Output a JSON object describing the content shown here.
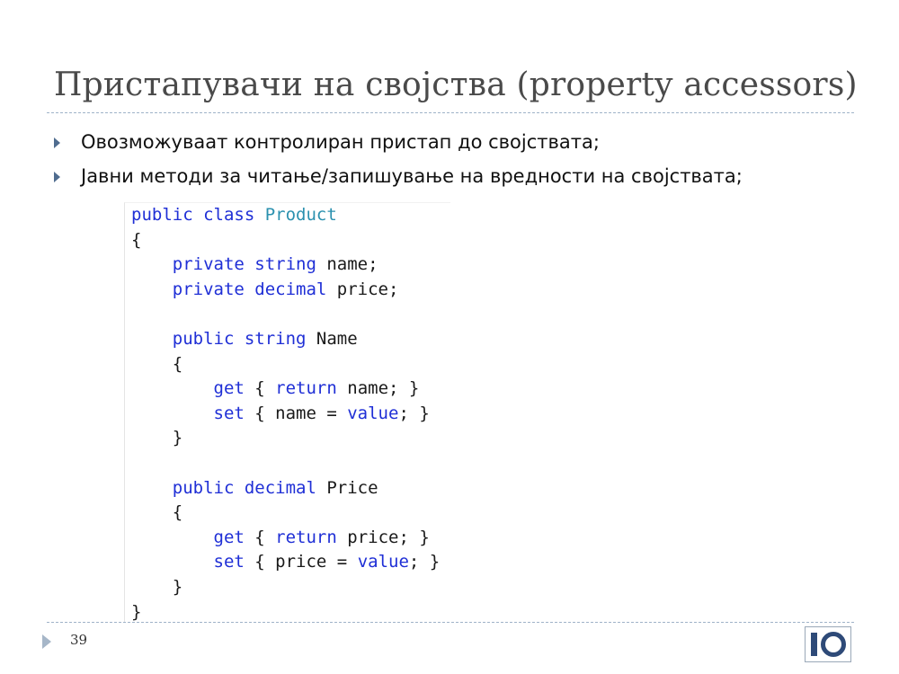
{
  "slide": {
    "title": "Пристапувачи на својства (property accessors)",
    "bullets": [
      "Овозможуваат контролиран пристап до својствата;",
      "Јавни методи за читање/запишување на вредности на својствата;"
    ],
    "code_lines": [
      [
        {
          "t": "public class ",
          "k": "kw"
        },
        {
          "t": "Product",
          "k": "ty"
        }
      ],
      [
        {
          "t": "{",
          "k": "pl"
        }
      ],
      [
        {
          "t": "    ",
          "k": "pl"
        },
        {
          "t": "private string ",
          "k": "kw"
        },
        {
          "t": "name;",
          "k": "pl"
        }
      ],
      [
        {
          "t": "    ",
          "k": "pl"
        },
        {
          "t": "private decimal ",
          "k": "kw"
        },
        {
          "t": "price;",
          "k": "pl"
        }
      ],
      [
        {
          "t": "",
          "k": "pl"
        }
      ],
      [
        {
          "t": "    ",
          "k": "pl"
        },
        {
          "t": "public string ",
          "k": "kw"
        },
        {
          "t": "Name",
          "k": "pl"
        }
      ],
      [
        {
          "t": "    {",
          "k": "pl"
        }
      ],
      [
        {
          "t": "        ",
          "k": "pl"
        },
        {
          "t": "get",
          "k": "kw"
        },
        {
          "t": " { ",
          "k": "pl"
        },
        {
          "t": "return",
          "k": "kw"
        },
        {
          "t": " name; }",
          "k": "pl"
        }
      ],
      [
        {
          "t": "        ",
          "k": "pl"
        },
        {
          "t": "set",
          "k": "kw"
        },
        {
          "t": " { name = ",
          "k": "pl"
        },
        {
          "t": "value",
          "k": "kw"
        },
        {
          "t": "; }",
          "k": "pl"
        }
      ],
      [
        {
          "t": "    }",
          "k": "pl"
        }
      ],
      [
        {
          "t": "",
          "k": "pl"
        }
      ],
      [
        {
          "t": "    ",
          "k": "pl"
        },
        {
          "t": "public decimal ",
          "k": "kw"
        },
        {
          "t": "Price",
          "k": "pl"
        }
      ],
      [
        {
          "t": "    {",
          "k": "pl"
        }
      ],
      [
        {
          "t": "        ",
          "k": "pl"
        },
        {
          "t": "get",
          "k": "kw"
        },
        {
          "t": " { ",
          "k": "pl"
        },
        {
          "t": "return",
          "k": "kw"
        },
        {
          "t": " price; }",
          "k": "pl"
        }
      ],
      [
        {
          "t": "        ",
          "k": "pl"
        },
        {
          "t": "set",
          "k": "kw"
        },
        {
          "t": " { price = ",
          "k": "pl"
        },
        {
          "t": "value",
          "k": "kw"
        },
        {
          "t": "; }",
          "k": "pl"
        }
      ],
      [
        {
          "t": "    }",
          "k": "pl"
        }
      ],
      [
        {
          "t": "}",
          "k": "pl"
        }
      ]
    ],
    "page_number": "39",
    "logo_text": "IO"
  },
  "colors": {
    "keyword": "#1f2fd6",
    "type": "#2b91af",
    "title": "#4a4a4a",
    "bullet_marker": "#4f6c8f",
    "logo": "#2e4a78"
  },
  "icons": {
    "bullet": "triangle-right-icon",
    "footer": "triangle-right-icon"
  }
}
